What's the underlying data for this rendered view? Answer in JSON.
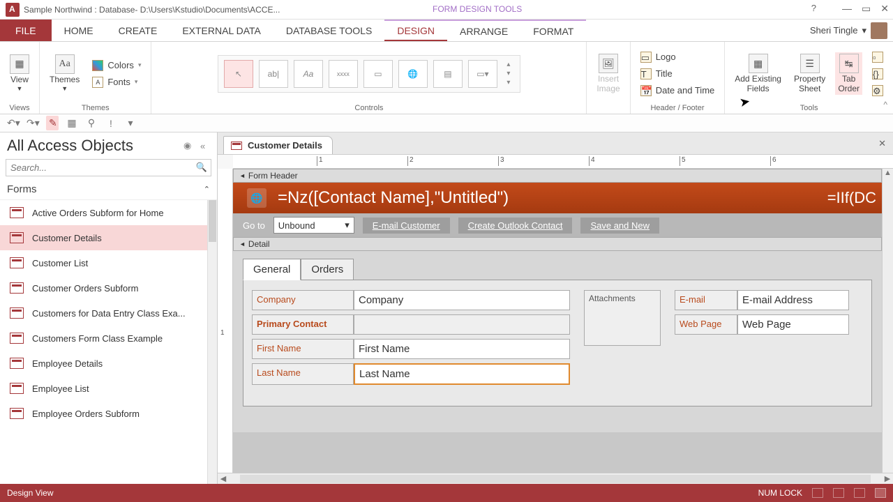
{
  "title": "Sample Northwind : Database- D:\\Users\\Kstudio\\Documents\\ACCE...",
  "contextual_tools": "FORM DESIGN TOOLS",
  "user_name": "Sheri Tingle",
  "tabs": {
    "file": "FILE",
    "home": "HOME",
    "create": "CREATE",
    "external": "EXTERNAL DATA",
    "dbtools": "DATABASE TOOLS",
    "design": "DESIGN",
    "arrange": "ARRANGE",
    "format": "FORMAT"
  },
  "ribbon": {
    "views": {
      "view": "View",
      "label": "Views"
    },
    "themes": {
      "themes": "Themes",
      "colors": "Colors",
      "fonts": "Fonts",
      "label": "Themes"
    },
    "controls": {
      "label": "Controls"
    },
    "image": {
      "insert": "Insert\nImage"
    },
    "headerfooter": {
      "logo": "Logo",
      "title": "Title",
      "datetime": "Date and Time",
      "label": "Header / Footer"
    },
    "tools": {
      "addfields": "Add Existing\nFields",
      "propsheet": "Property\nSheet",
      "taborder": "Tab\nOrder",
      "label": "Tools"
    }
  },
  "nav": {
    "heading": "All Access Objects",
    "search_placeholder": "Search...",
    "category": "Forms",
    "items": [
      "Active Orders Subform for Home",
      "Customer Details",
      "Customer List",
      "Customer Orders Subform",
      "Customers for Data Entry Class Exa...",
      "Customers Form Class Example",
      "Employee Details",
      "Employee List",
      "Employee Orders Subform"
    ],
    "selected_index": 1
  },
  "doc": {
    "tab": "Customer Details",
    "form_header_section": "Form Header",
    "detail_section": "Detail",
    "title_expr": "=Nz([Contact Name],\"Untitled\")",
    "right_expr": "=IIf(DC",
    "goto": "Go to",
    "unbound": "Unbound",
    "btn_email": "E-mail Customer",
    "btn_outlook": "Create Outlook Contact",
    "btn_save": "Save and New",
    "tab_general": "General",
    "tab_orders": "Orders",
    "labels": {
      "company": "Company",
      "primary": "Primary Contact",
      "first": "First Name",
      "last": "Last Name",
      "attachments": "Attachments",
      "email": "E-mail",
      "web": "Web Page"
    },
    "values": {
      "company": "Company",
      "first": "First Name",
      "last": "Last Name",
      "email": "E-mail Address",
      "web": "Web Page"
    }
  },
  "status": {
    "left": "Design View",
    "numlock": "NUM LOCK"
  },
  "ruler_marks": [
    "1",
    "2",
    "3",
    "4",
    "5",
    "6"
  ]
}
